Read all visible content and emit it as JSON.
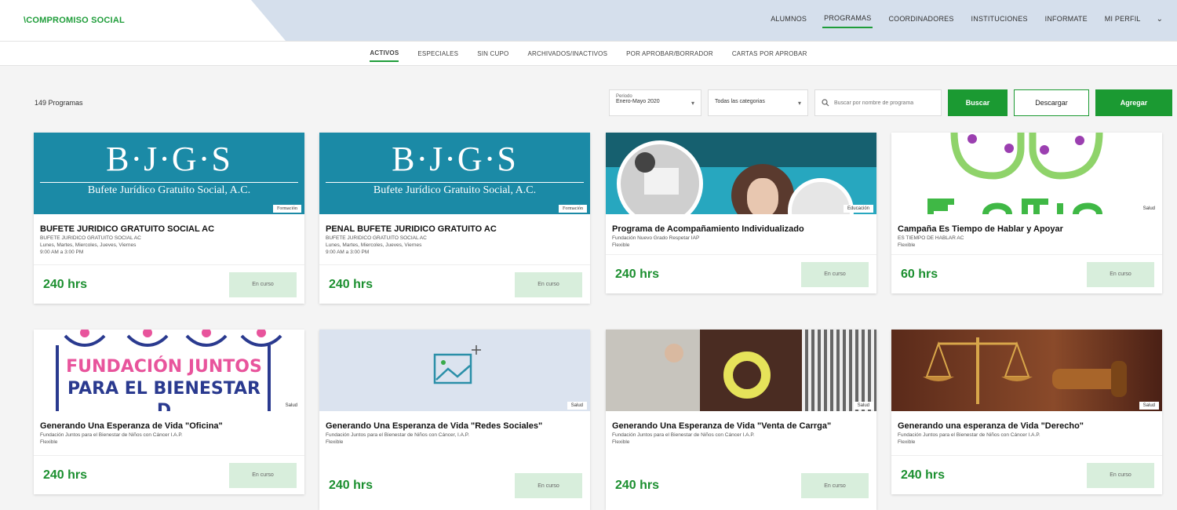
{
  "header": {
    "logo": "\\COMPROMISO SOCIAL",
    "nav": [
      "ALUMNOS",
      "PROGRAMAS",
      "COORDINADORES",
      "INSTITUCIONES",
      "INFORMATE",
      "MI PERFIL"
    ]
  },
  "subnav": [
    "ACTIVOS",
    "ESPECIALES",
    "SIN CUPO",
    "ARCHIVADOS/INACTIVOS",
    "POR APROBAR/BORRADOR",
    "CARTAS POR APROBAR"
  ],
  "toolbar": {
    "count": "149 Programas",
    "period_label": "Periodo",
    "period_value": "Enero-Mayo 2020",
    "category": "Todas las categorias",
    "search_placeholder": "Buscar por nombre de programa",
    "search_btn": "Buscar",
    "download_btn": "Descargar",
    "add_btn": "Agregar"
  },
  "cards": [
    {
      "title": "BUFETE JURIDICO GRATUITO SOCIAL AC",
      "sub1": "BUFETE JURIDICO GRATUITO SOCIAL AC",
      "sub2": "Lunes, Martes, Miercoles, Jueves, Viernes",
      "sub3": "9:00 AM a 3:00 PM",
      "hours": "240 hrs",
      "status": "En curso",
      "badge": "Formación",
      "img": {
        "big": "B·J·G·S",
        "small": "Bufete Jurídico Gratuito Social, A.C."
      }
    },
    {
      "title": "PENAL BUFETE JURIDICO GRATUITO AC",
      "sub1": "BUFETE JURIDICO GRATUITO SOCIAL AC",
      "sub2": "Lunes, Martes, Miercoles, Jueves, Viernes",
      "sub3": "9:00 AM a 3:00 PM",
      "hours": "240 hrs",
      "status": "En curso",
      "badge": "Formación",
      "img": {
        "big": "B·J·G·S",
        "small": "Bufete Jurídico Gratuito Social, A.C."
      }
    },
    {
      "title": "Programa de Acompañamiento Individualizado",
      "sub1": "Fundación Nuevo Grado Respetar IAP",
      "sub2": "Flexible",
      "hours": "240 hrs",
      "status": "En curso",
      "badge": "Educación"
    },
    {
      "title": "Campaña Es Tiempo de Hablar y Apoyar",
      "sub1": "ES TIEMPO DE HABLAR AC",
      "sub2": "Flexible",
      "hours": "60 hrs",
      "status": "En curso",
      "badge": "Salud"
    },
    {
      "title": "Generando Una Esperanza de Vida \"Oficina\"",
      "sub1": "Fundación Juntos para el Bienestar de Niños con Cáncer I.A.P.",
      "sub2": "Flexible",
      "hours": "240 hrs",
      "status": "En curso",
      "badge": "Salud",
      "img": {
        "line1": "FUNDACIÓN JUNTOS",
        "line2": "PARA EL BIENESTAR D"
      }
    },
    {
      "title": "Generando Una Esperanza de Vida \"Redes Sociales\"",
      "sub1": "Fundación Juntos para el Bienestar de Niños con Cáncer, I.A.P.",
      "sub2": "Flexible",
      "hours": "240 hrs",
      "status": "En curso",
      "badge": "Salud"
    },
    {
      "title": "Generando Una Esperanza de Vida \"Venta de Carrga\"",
      "sub1": "Fundación Juntos para el Bienestar de Niños con Cáncer I.A.P.",
      "sub2": "Flexible",
      "hours": "240 hrs",
      "status": "En curso",
      "badge": "Salud"
    },
    {
      "title": "Generando una esperanza de Vida \"Derecho\"",
      "sub1": "Fundación Juntos para el Bienestar de Niños con Cáncer I.A.P.",
      "sub2": "Flexible",
      "hours": "240 hrs",
      "status": "En curso",
      "badge": "Salud"
    }
  ]
}
